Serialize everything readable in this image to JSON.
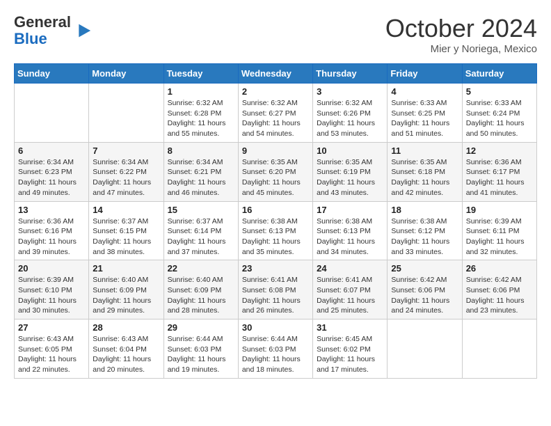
{
  "logo": {
    "general": "General",
    "blue": "Blue"
  },
  "header": {
    "month": "October 2024",
    "location": "Mier y Noriega, Mexico"
  },
  "weekdays": [
    "Sunday",
    "Monday",
    "Tuesday",
    "Wednesday",
    "Thursday",
    "Friday",
    "Saturday"
  ],
  "weeks": [
    [
      {
        "day": "",
        "content": ""
      },
      {
        "day": "",
        "content": ""
      },
      {
        "day": "1",
        "content": "Sunrise: 6:32 AM\nSunset: 6:28 PM\nDaylight: 11 hours and 55 minutes."
      },
      {
        "day": "2",
        "content": "Sunrise: 6:32 AM\nSunset: 6:27 PM\nDaylight: 11 hours and 54 minutes."
      },
      {
        "day": "3",
        "content": "Sunrise: 6:32 AM\nSunset: 6:26 PM\nDaylight: 11 hours and 53 minutes."
      },
      {
        "day": "4",
        "content": "Sunrise: 6:33 AM\nSunset: 6:25 PM\nDaylight: 11 hours and 51 minutes."
      },
      {
        "day": "5",
        "content": "Sunrise: 6:33 AM\nSunset: 6:24 PM\nDaylight: 11 hours and 50 minutes."
      }
    ],
    [
      {
        "day": "6",
        "content": "Sunrise: 6:34 AM\nSunset: 6:23 PM\nDaylight: 11 hours and 49 minutes."
      },
      {
        "day": "7",
        "content": "Sunrise: 6:34 AM\nSunset: 6:22 PM\nDaylight: 11 hours and 47 minutes."
      },
      {
        "day": "8",
        "content": "Sunrise: 6:34 AM\nSunset: 6:21 PM\nDaylight: 11 hours and 46 minutes."
      },
      {
        "day": "9",
        "content": "Sunrise: 6:35 AM\nSunset: 6:20 PM\nDaylight: 11 hours and 45 minutes."
      },
      {
        "day": "10",
        "content": "Sunrise: 6:35 AM\nSunset: 6:19 PM\nDaylight: 11 hours and 43 minutes."
      },
      {
        "day": "11",
        "content": "Sunrise: 6:35 AM\nSunset: 6:18 PM\nDaylight: 11 hours and 42 minutes."
      },
      {
        "day": "12",
        "content": "Sunrise: 6:36 AM\nSunset: 6:17 PM\nDaylight: 11 hours and 41 minutes."
      }
    ],
    [
      {
        "day": "13",
        "content": "Sunrise: 6:36 AM\nSunset: 6:16 PM\nDaylight: 11 hours and 39 minutes."
      },
      {
        "day": "14",
        "content": "Sunrise: 6:37 AM\nSunset: 6:15 PM\nDaylight: 11 hours and 38 minutes."
      },
      {
        "day": "15",
        "content": "Sunrise: 6:37 AM\nSunset: 6:14 PM\nDaylight: 11 hours and 37 minutes."
      },
      {
        "day": "16",
        "content": "Sunrise: 6:38 AM\nSunset: 6:13 PM\nDaylight: 11 hours and 35 minutes."
      },
      {
        "day": "17",
        "content": "Sunrise: 6:38 AM\nSunset: 6:13 PM\nDaylight: 11 hours and 34 minutes."
      },
      {
        "day": "18",
        "content": "Sunrise: 6:38 AM\nSunset: 6:12 PM\nDaylight: 11 hours and 33 minutes."
      },
      {
        "day": "19",
        "content": "Sunrise: 6:39 AM\nSunset: 6:11 PM\nDaylight: 11 hours and 32 minutes."
      }
    ],
    [
      {
        "day": "20",
        "content": "Sunrise: 6:39 AM\nSunset: 6:10 PM\nDaylight: 11 hours and 30 minutes."
      },
      {
        "day": "21",
        "content": "Sunrise: 6:40 AM\nSunset: 6:09 PM\nDaylight: 11 hours and 29 minutes."
      },
      {
        "day": "22",
        "content": "Sunrise: 6:40 AM\nSunset: 6:09 PM\nDaylight: 11 hours and 28 minutes."
      },
      {
        "day": "23",
        "content": "Sunrise: 6:41 AM\nSunset: 6:08 PM\nDaylight: 11 hours and 26 minutes."
      },
      {
        "day": "24",
        "content": "Sunrise: 6:41 AM\nSunset: 6:07 PM\nDaylight: 11 hours and 25 minutes."
      },
      {
        "day": "25",
        "content": "Sunrise: 6:42 AM\nSunset: 6:06 PM\nDaylight: 11 hours and 24 minutes."
      },
      {
        "day": "26",
        "content": "Sunrise: 6:42 AM\nSunset: 6:06 PM\nDaylight: 11 hours and 23 minutes."
      }
    ],
    [
      {
        "day": "27",
        "content": "Sunrise: 6:43 AM\nSunset: 6:05 PM\nDaylight: 11 hours and 22 minutes."
      },
      {
        "day": "28",
        "content": "Sunrise: 6:43 AM\nSunset: 6:04 PM\nDaylight: 11 hours and 20 minutes."
      },
      {
        "day": "29",
        "content": "Sunrise: 6:44 AM\nSunset: 6:03 PM\nDaylight: 11 hours and 19 minutes."
      },
      {
        "day": "30",
        "content": "Sunrise: 6:44 AM\nSunset: 6:03 PM\nDaylight: 11 hours and 18 minutes."
      },
      {
        "day": "31",
        "content": "Sunrise: 6:45 AM\nSunset: 6:02 PM\nDaylight: 11 hours and 17 minutes."
      },
      {
        "day": "",
        "content": ""
      },
      {
        "day": "",
        "content": ""
      }
    ]
  ]
}
